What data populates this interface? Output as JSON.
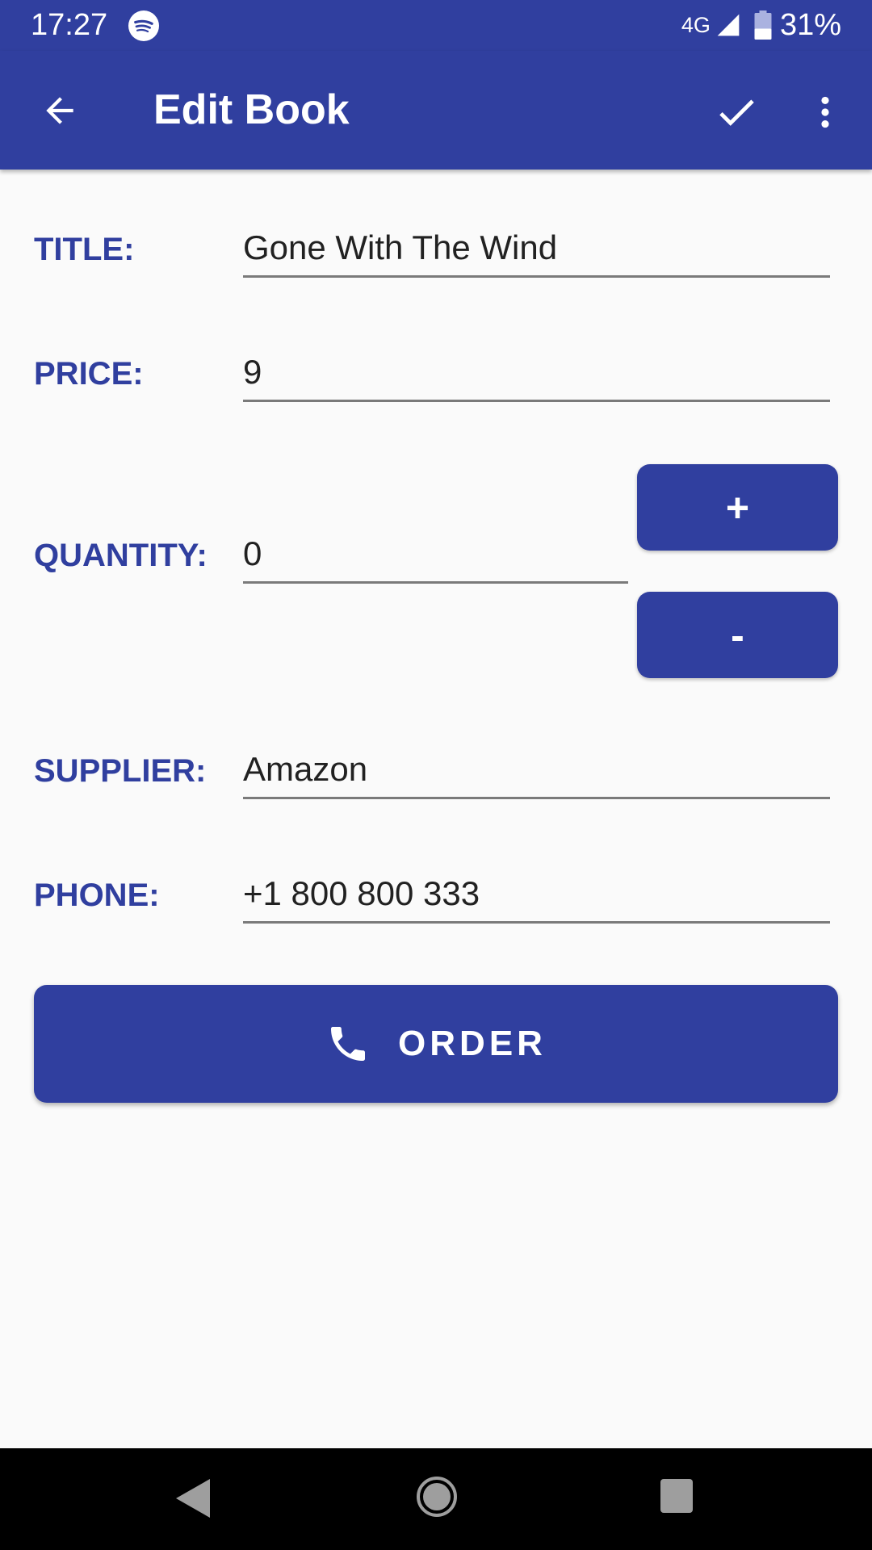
{
  "status_bar": {
    "time": "17:27",
    "network": "4G",
    "battery": "31%",
    "icons": [
      "spotify-icon",
      "signal-icon",
      "battery-icon"
    ]
  },
  "app_bar": {
    "title": "Edit Book",
    "icons": [
      "back-arrow-icon",
      "check-icon",
      "more-vert-icon"
    ]
  },
  "form": {
    "title_label": "TITLE:",
    "title_value": "Gone With The Wind",
    "price_label": "PRICE:",
    "price_value": "9",
    "quantity_label": "QUANTITY:",
    "quantity_value": "0",
    "increment_label": "+",
    "decrement_label": "-",
    "supplier_label": "SUPPLIER:",
    "supplier_value": "Amazon",
    "phone_label": "PHONE:",
    "phone_value": "+1 800 800 333"
  },
  "order_button": {
    "label": "ORDER",
    "icon": "phone-icon"
  },
  "nav_bar": {
    "icons": [
      "nav-back-icon",
      "nav-home-icon",
      "nav-recents-icon"
    ]
  },
  "colors": {
    "primary": "#303f9f",
    "background": "#fafafa",
    "text": "#212121",
    "underline": "#7a7a7a"
  }
}
